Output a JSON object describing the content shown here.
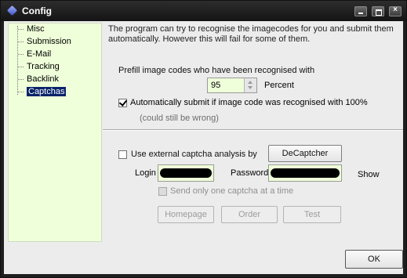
{
  "window": {
    "title": "Config",
    "controls": [
      "minimize",
      "maximize",
      "close"
    ]
  },
  "sidebar": {
    "items": [
      {
        "label": "Misc",
        "selected": false
      },
      {
        "label": "Submission",
        "selected": false
      },
      {
        "label": "E-Mail",
        "selected": false
      },
      {
        "label": "Tracking",
        "selected": false
      },
      {
        "label": "Backlink",
        "selected": false
      },
      {
        "label": "Captchas",
        "selected": true
      }
    ]
  },
  "captchas": {
    "intro": "The program can try to recognise the imagecodes for you and submit them automatically. However this will fail for some of them.",
    "prefill_label": "Prefill image codes who have been recognised with",
    "prefill_value": "95",
    "percent_label": "Percent",
    "auto_submit_label": "Automatically submit if image code was recognised with 100%",
    "auto_submit_checked": true,
    "hint": "(could still be wrong)",
    "external_label": "Use external captcha analysis by",
    "external_checked": false,
    "service_button": "DeCaptcher",
    "login_label": "Login",
    "password_label": "Password",
    "show_label": "Show",
    "one_at_a_time_label": "Send only one captcha at a time",
    "one_at_a_time_checked": false,
    "homepage_button": "Homepage",
    "order_button": "Order",
    "test_button": "Test"
  },
  "footer": {
    "ok_button": "OK"
  },
  "colors": {
    "sidebar_bg": "#efffd9",
    "selection": "#0a246a",
    "titlebar": "#1e1e1e"
  }
}
